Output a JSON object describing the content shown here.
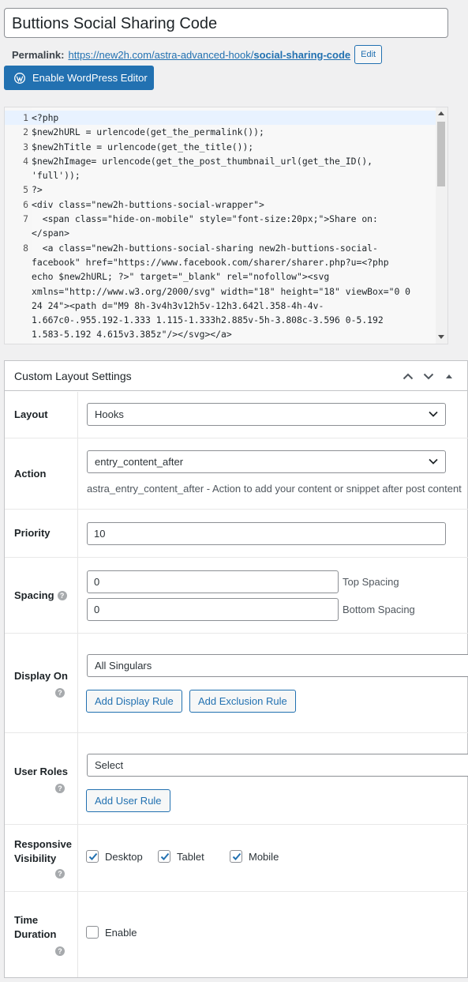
{
  "post": {
    "title": "Buttions Social Sharing Code",
    "permalink_label": "Permalink:",
    "permalink_base": "https://new2h.com/astra-advanced-hook/",
    "permalink_slug": "social-sharing-code",
    "edit_label": "Edit",
    "enable_editor_label": "Enable WordPress Editor"
  },
  "code_editor": {
    "lines": [
      {
        "n": "1",
        "text": "<?php"
      },
      {
        "n": "2",
        "text": "$new2hURL = urlencode(get_the_permalink());"
      },
      {
        "n": "3",
        "text": "$new2hTitle = urlencode(get_the_title());"
      },
      {
        "n": "4",
        "text": "$new2hImage= urlencode(get_the_post_thumbnail_url(get_the_ID(),"
      },
      {
        "n": "",
        "text": "'full'));"
      },
      {
        "n": "5",
        "text": "?>"
      },
      {
        "n": "6",
        "text": "<div class=\"new2h-buttions-social-wrapper\">"
      },
      {
        "n": "7",
        "text": "  <span class=\"hide-on-mobile\" style=\"font-size:20px;\">Share on:"
      },
      {
        "n": "",
        "text": "</span>"
      },
      {
        "n": "8",
        "text": "  <a class=\"new2h-buttions-social-sharing new2h-buttions-social-"
      },
      {
        "n": "",
        "text": "facebook\" href=\"https://www.facebook.com/sharer/sharer.php?u=<?php"
      },
      {
        "n": "",
        "text": "echo $new2hURL; ?>\" target=\"_blank\" rel=\"nofollow\"><svg"
      },
      {
        "n": "",
        "text": "xmlns=\"http://www.w3.org/2000/svg\" width=\"18\" height=\"18\" viewBox=\"0 0"
      },
      {
        "n": "",
        "text": "24 24\"><path d=\"M9 8h-3v4h3v12h5v-12h3.642l.358-4h-4v-"
      },
      {
        "n": "",
        "text": "1.667c0-.955.192-1.333 1.115-1.333h2.885v-5h-3.808c-3.596 0-5.192"
      },
      {
        "n": "",
        "text": "1.583-5.192 4.615v3.385z\"/></svg></a>"
      }
    ]
  },
  "metabox": {
    "title": "Custom Layout Settings",
    "layout": {
      "label": "Layout",
      "value": "Hooks"
    },
    "action": {
      "label": "Action",
      "value": "entry_content_after",
      "description": "astra_entry_content_after - Action to add your content or snippet after post content"
    },
    "priority": {
      "label": "Priority",
      "value": "10"
    },
    "spacing": {
      "label": "Spacing",
      "top_value": "0",
      "top_label": "Top Spacing",
      "bottom_value": "0",
      "bottom_label": "Bottom Spacing"
    },
    "display_on": {
      "label": "Display On",
      "value": "All Singulars",
      "add_display_rule": "Add Display Rule",
      "add_exclusion_rule": "Add Exclusion Rule"
    },
    "user_roles": {
      "label": "User Roles",
      "value": "Select",
      "add_user_rule": "Add User Rule"
    },
    "responsive": {
      "label_line1": "Responsive",
      "label_line2": "Visibility",
      "desktop": "Desktop",
      "tablet": "Tablet",
      "mobile": "Mobile",
      "desktop_checked": true,
      "tablet_checked": true,
      "mobile_checked": true
    },
    "time_duration": {
      "label_line1": "Time",
      "label_line2": "Duration",
      "enable": "Enable",
      "enabled": false
    }
  },
  "colors": {
    "primary": "#2271b1",
    "help_icon": "#a7aaad"
  },
  "icons": [
    "wordpress-icon",
    "chevron-up-icon",
    "chevron-down-icon",
    "triangle-up-icon",
    "help-icon",
    "checkmark-icon"
  ]
}
